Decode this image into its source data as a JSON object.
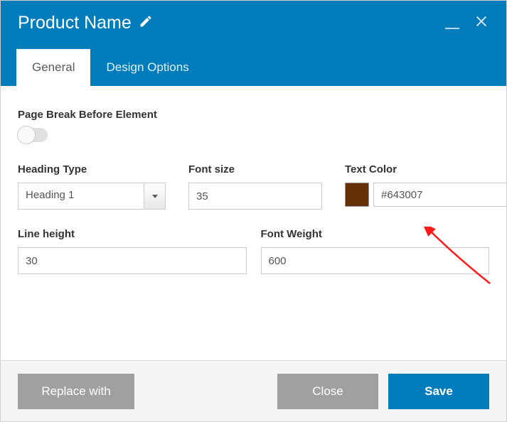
{
  "header": {
    "title": "Product Name"
  },
  "tabs": {
    "general": "General",
    "design": "Design Options"
  },
  "fields": {
    "pageBreak": {
      "label": "Page Break Before Element"
    },
    "headingType": {
      "label": "Heading Type",
      "value": "Heading 1"
    },
    "fontSize": {
      "label": "Font size",
      "value": "35"
    },
    "textColor": {
      "label": "Text Color",
      "value": "#643007",
      "swatch": "#643007"
    },
    "lineHeight": {
      "label": "Line height",
      "value": "30"
    },
    "fontWeight": {
      "label": "Font Weight",
      "value": "600"
    }
  },
  "footer": {
    "replace": "Replace with",
    "close": "Close",
    "save": "Save"
  }
}
